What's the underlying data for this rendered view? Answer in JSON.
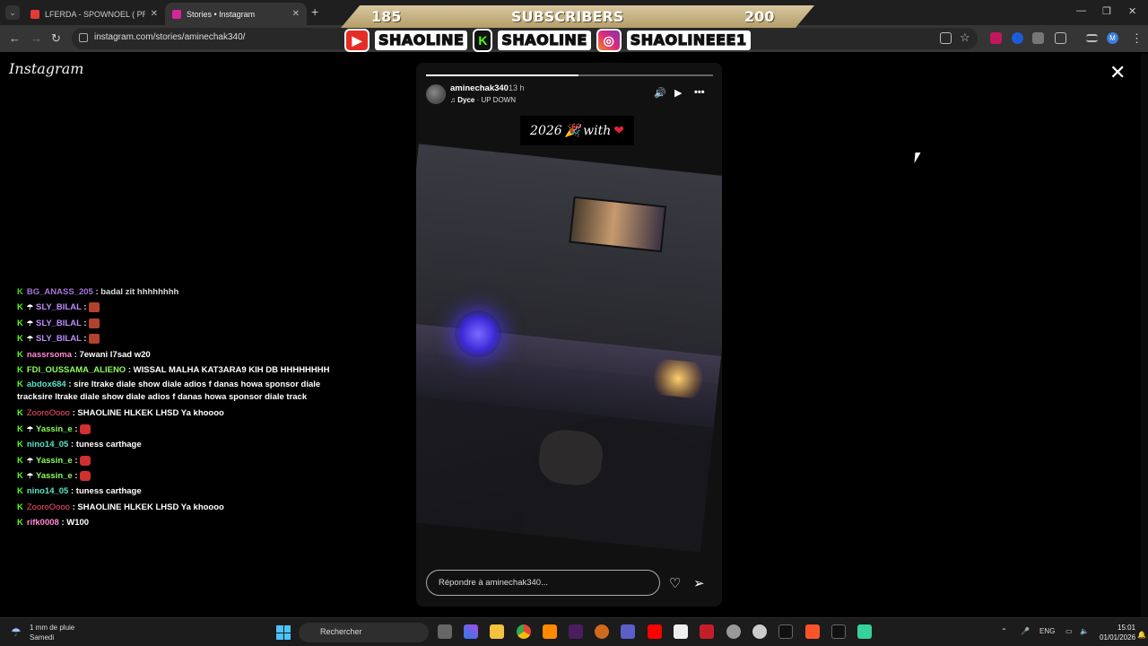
{
  "browser": {
    "tabs": [
      {
        "title": "LFERDA - SPOWNOEL ( PROD B",
        "favicon_color": "#e53935",
        "active": false
      },
      {
        "title": "Stories • Instagram",
        "favicon_color": "#d6249f",
        "active": true
      }
    ],
    "url": "instagram.com/stories/aminechak340/",
    "new_tab": "+",
    "window_controls": {
      "minimize": "—",
      "restore": "❐",
      "close": "✕"
    }
  },
  "overlay": {
    "subs_current": "185",
    "subs_label": "SUBSCRIBERS",
    "subs_goal": "200",
    "social": [
      {
        "platform": "youtube-icon",
        "name": "SHAOLINE",
        "color": "#e52d27"
      },
      {
        "platform": "kick-icon",
        "name": "SHAOLINE",
        "color": "#53fc18"
      },
      {
        "platform": "instagram-icon",
        "name": "SHAOLINEEE1",
        "color": "#d6249f"
      }
    ]
  },
  "instagram": {
    "logo": "Instagram",
    "close": "✕",
    "story": {
      "progress": 0.53,
      "username": "aminechak340",
      "time": "13 h",
      "music_artist": "Dyce",
      "music_track": " · UP DOWN",
      "sticker_year": "2026",
      "sticker_emoji": "🎉",
      "sticker_word": "with",
      "sticker_heart": "❤",
      "reply_placeholder": "Répondre à aminechak340..."
    }
  },
  "chat": [
    {
      "user": "BG_ANASS_205",
      "msg": ": badal zit hhhhhhhh",
      "color": "purple",
      "emote": false,
      "partial": true
    },
    {
      "user": "SLY_BILAL",
      "msg": ":",
      "color": "purple",
      "emote": true
    },
    {
      "user": "SLY_BILAL",
      "msg": ":",
      "color": "purple",
      "emote": true
    },
    {
      "user": "SLY_BILAL",
      "msg": ":",
      "color": "purple",
      "emote": true
    },
    {
      "user": "nassrsoma",
      "msg": ": 7ewani l7sad w20",
      "color": "pink",
      "emote": false
    },
    {
      "user": "FDI_OUSSAMA_ALIENO",
      "msg": ": WISSAL MALHA KAT3ARA9 KIH DB HHHHHHHH",
      "color": "green",
      "emote": false
    },
    {
      "user": "abdox684",
      "msg": ": sire ltrake diale show diale adios f danas howa sponsor diale tracksire ltrake diale show diale adios f danas howa sponsor diale track",
      "color": "teal",
      "emote": false,
      "wrap": true
    },
    {
      "user": "ZooroOooo",
      "msg": ": SHAOLINE HLKEK LHSD Ya khoooo",
      "color": "red",
      "emote": false
    },
    {
      "user": "Yassin_e",
      "msg": ":",
      "color": "green",
      "emote": true,
      "red": true
    },
    {
      "user": "nino14_05",
      "msg": ": tuness carthage",
      "color": "teal",
      "emote": false
    },
    {
      "user": "Yassin_e",
      "msg": ":",
      "color": "green",
      "emote": true,
      "red": true
    },
    {
      "user": "Yassin_e",
      "msg": ":",
      "color": "green",
      "emote": true,
      "red": true
    },
    {
      "user": "nino14_05",
      "msg": ": tuness carthage",
      "color": "teal",
      "emote": false
    },
    {
      "user": "ZooroOooo",
      "msg": ": SHAOLINE HLKEK LHSD Ya khoooo",
      "color": "red",
      "emote": false
    },
    {
      "user": "rifk0008",
      "msg": ": W100",
      "color": "pink",
      "emote": false
    }
  ],
  "taskbar": {
    "weather_line1": "1 mm de pluie",
    "weather_line2": "Samedi",
    "search_placeholder": "Rechercher",
    "lang": "ENG",
    "time": "15:01",
    "date": "01/01/2026"
  }
}
